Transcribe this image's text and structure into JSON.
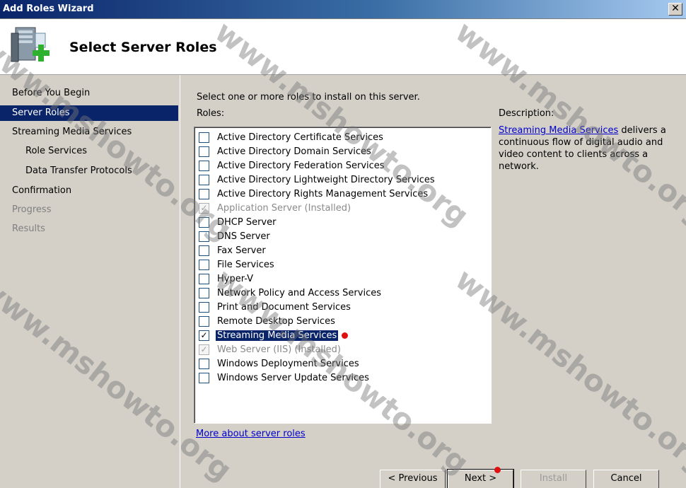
{
  "window": {
    "title": "Add Roles Wizard",
    "close_glyph": "✕"
  },
  "header": {
    "title": "Select Server Roles",
    "icon": "server-add-icon"
  },
  "sidebar": {
    "items": [
      {
        "label": "Before You Begin",
        "state": "normal"
      },
      {
        "label": "Server Roles",
        "state": "active"
      },
      {
        "label": "Streaming Media Services",
        "state": "normal"
      },
      {
        "label": "Role Services",
        "state": "normal"
      },
      {
        "label": "Data Transfer Protocols",
        "state": "normal"
      },
      {
        "label": "Confirmation",
        "state": "normal"
      },
      {
        "label": "Progress",
        "state": "disabled"
      },
      {
        "label": "Results",
        "state": "disabled"
      }
    ]
  },
  "main": {
    "instruction": "Select one or more roles to install on this server.",
    "roles_label": "Roles:",
    "roles": [
      {
        "label": "Active Directory Certificate Services",
        "checked": false,
        "disabled": false
      },
      {
        "label": "Active Directory Domain Services",
        "checked": false,
        "disabled": false
      },
      {
        "label": "Active Directory Federation Services",
        "checked": false,
        "disabled": false
      },
      {
        "label": "Active Directory Lightweight Directory Services",
        "checked": false,
        "disabled": false
      },
      {
        "label": "Active Directory Rights Management Services",
        "checked": false,
        "disabled": false
      },
      {
        "label": "Application Server  (Installed)",
        "checked": true,
        "disabled": true
      },
      {
        "label": "DHCP Server",
        "checked": false,
        "disabled": false
      },
      {
        "label": "DNS Server",
        "checked": false,
        "disabled": false
      },
      {
        "label": "Fax Server",
        "checked": false,
        "disabled": false
      },
      {
        "label": "File Services",
        "checked": false,
        "disabled": false
      },
      {
        "label": "Hyper-V",
        "checked": false,
        "disabled": false
      },
      {
        "label": "Network Policy and Access Services",
        "checked": false,
        "disabled": false
      },
      {
        "label": "Print and Document Services",
        "checked": false,
        "disabled": false
      },
      {
        "label": "Remote Desktop Services",
        "checked": false,
        "disabled": false
      },
      {
        "label": "Streaming Media Services",
        "checked": true,
        "disabled": false,
        "selected": true
      },
      {
        "label": "Web Server (IIS)  (Installed)",
        "checked": true,
        "disabled": true
      },
      {
        "label": "Windows Deployment Services",
        "checked": false,
        "disabled": false
      },
      {
        "label": "Windows Server Update Services",
        "checked": false,
        "disabled": false
      }
    ],
    "description_label": "Description:",
    "description_link": "Streaming Media Services",
    "description_text": " delivers a continuous flow of digital audio and video content to clients across a network.",
    "more_link": "More about server roles"
  },
  "buttons": {
    "previous": "< Previous",
    "next": "Next >",
    "install": "Install",
    "cancel": "Cancel"
  },
  "watermark": "www.mshowto.org",
  "accent_color": "#0a246a"
}
